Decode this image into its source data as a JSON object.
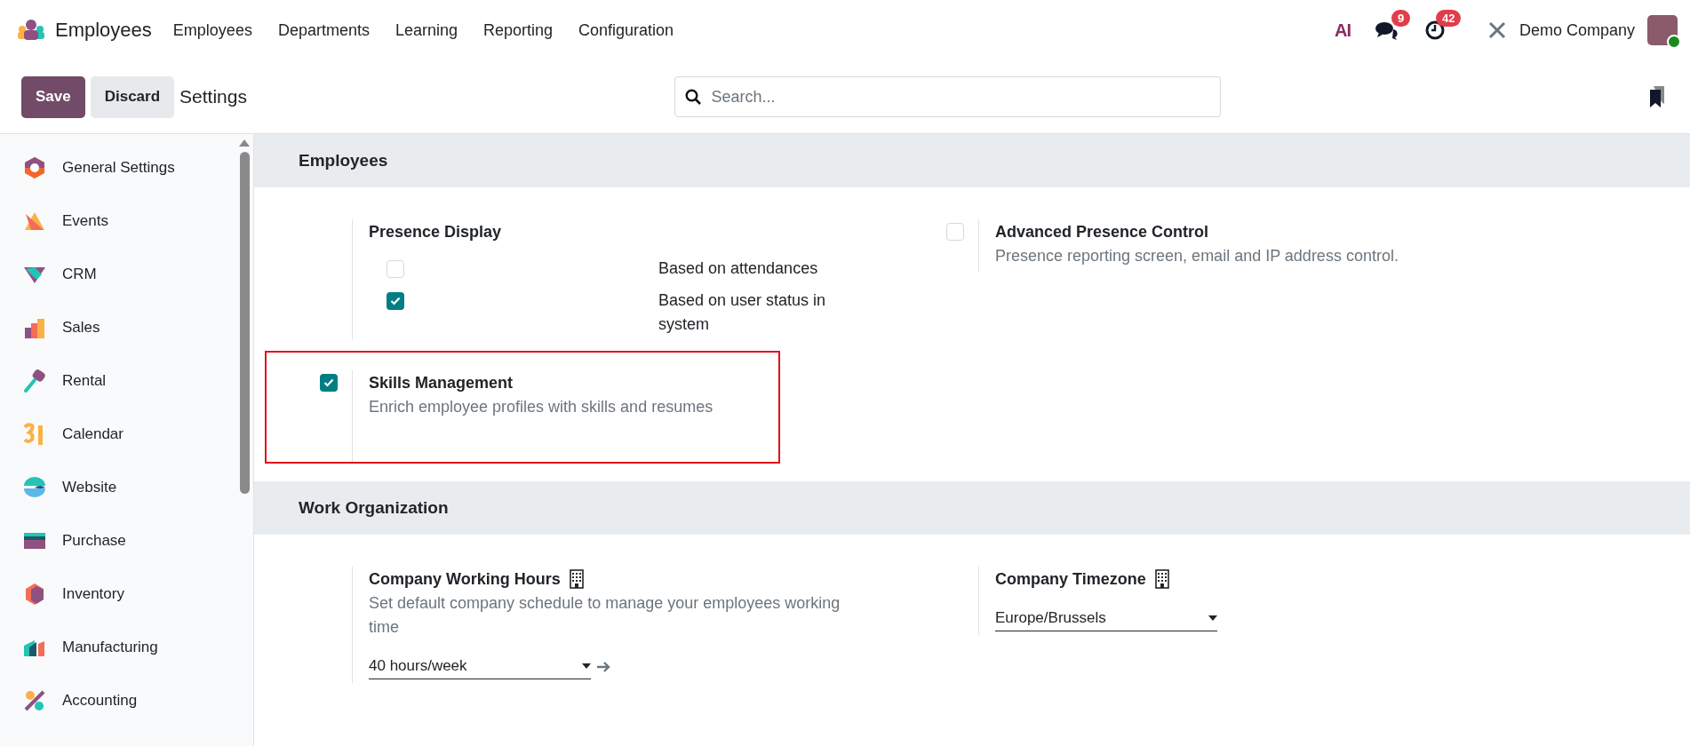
{
  "app": {
    "name": "Employees"
  },
  "menu": [
    "Employees",
    "Departments",
    "Learning",
    "Reporting",
    "Configuration"
  ],
  "systray": {
    "ai": "AI",
    "messages_count": "9",
    "activities_count": "42",
    "company": "Demo Company"
  },
  "control_bar": {
    "save": "Save",
    "discard": "Discard",
    "title": "Settings",
    "search": {
      "placeholder": "Search..."
    }
  },
  "sidebar": {
    "items": [
      {
        "label": "General Settings"
      },
      {
        "label": "Events"
      },
      {
        "label": "CRM"
      },
      {
        "label": "Sales"
      },
      {
        "label": "Rental"
      },
      {
        "label": "Calendar"
      },
      {
        "label": "Website"
      },
      {
        "label": "Purchase"
      },
      {
        "label": "Inventory"
      },
      {
        "label": "Manufacturing"
      },
      {
        "label": "Accounting"
      }
    ]
  },
  "sections": [
    {
      "title": "Employees",
      "settings": [
        {
          "kind": "options",
          "title": "Presence Display",
          "highlighted": false,
          "options": [
            {
              "label": "Based on attendances",
              "checked": false
            },
            {
              "label": "Based on user status in system",
              "checked": true
            }
          ]
        },
        {
          "kind": "checkbox",
          "title": "Advanced Presence Control",
          "description": "Presence reporting screen, email and IP address control.",
          "checked": false,
          "highlighted": false
        },
        {
          "kind": "checkbox",
          "title": "Skills Management",
          "description": "Enrich employee profiles with skills and resumes",
          "checked": true,
          "highlighted": true
        }
      ]
    },
    {
      "title": "Work Organization",
      "settings": [
        {
          "kind": "select",
          "title": "Company Working Hours",
          "description": "Set default company schedule to manage your employees working time",
          "value": "40 hours/week",
          "company_icon": true,
          "link_arrow": true,
          "highlighted": false
        },
        {
          "kind": "select",
          "title": "Company Timezone",
          "value": "Europe/Brussels",
          "company_icon": true,
          "highlighted": false
        }
      ]
    }
  ]
}
